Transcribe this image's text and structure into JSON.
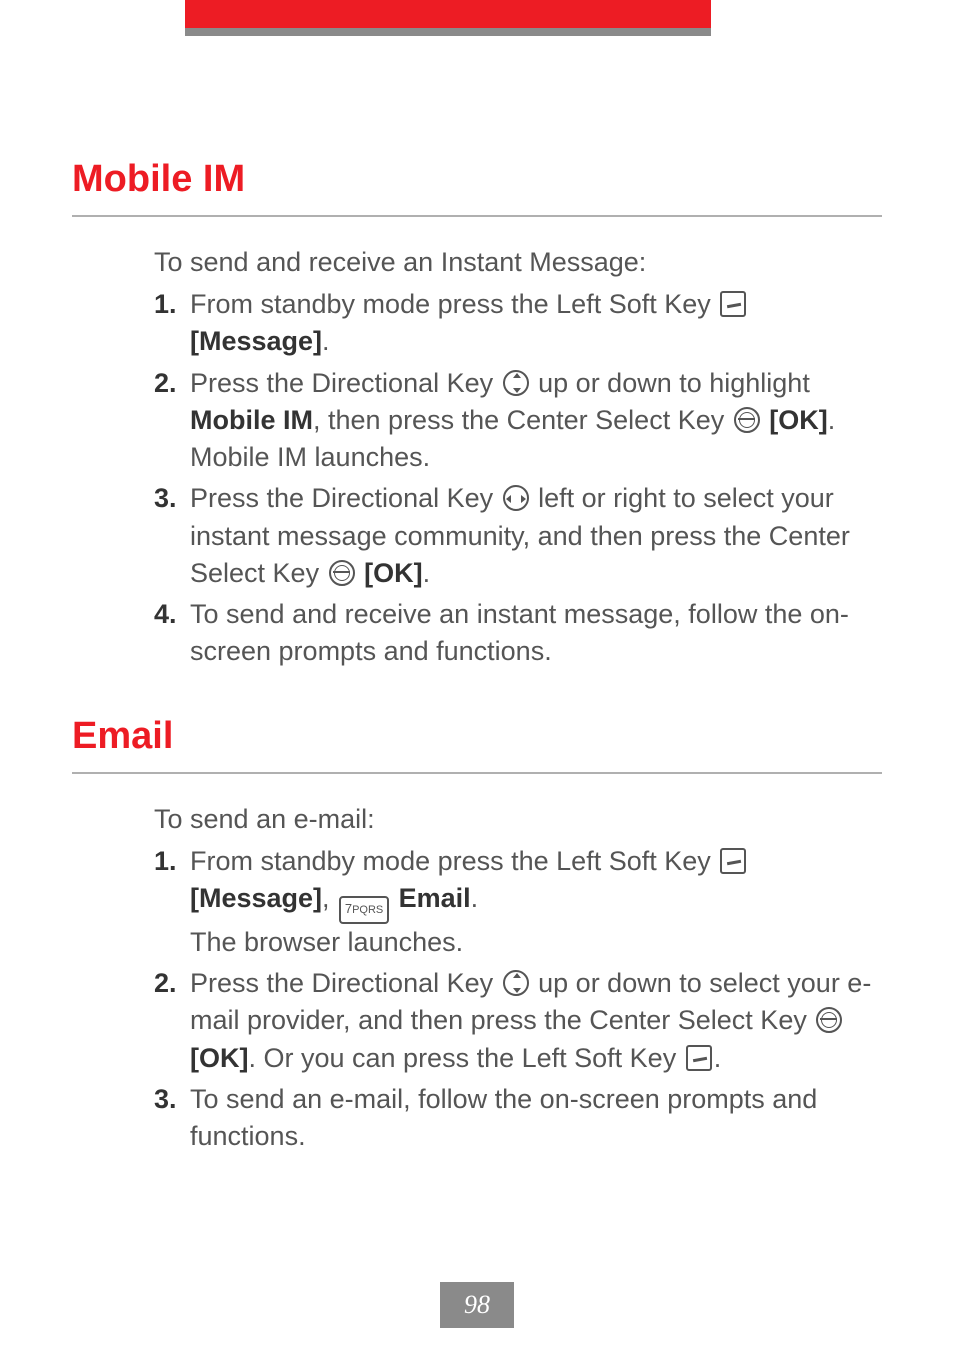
{
  "page_number": "98",
  "sections": [
    {
      "heading": "Mobile IM",
      "intro": "To send and receive an Instant Message:",
      "items": [
        {
          "num": "1.",
          "text1": "From standby mode press the Left Soft Key ",
          "bold1": "[Message]",
          "text2": "."
        },
        {
          "num": "2.",
          "text1": "Press the Directional Key ",
          "text2": " up or down to highlight ",
          "bold1": "Mobile IM",
          "text3": ", then press the Center Select Key ",
          "bold2": "[OK]",
          "text4": ".",
          "sub": "Mobile IM launches."
        },
        {
          "num": "3.",
          "text1": "Press the Directional Key ",
          "text2": " left or right to select your instant message community, and then press the Center Select Key ",
          "bold1": "[OK]",
          "text3": "."
        },
        {
          "num": "4.",
          "text1": "To send and receive an instant message, follow the on-screen prompts and functions."
        }
      ]
    },
    {
      "heading": "Email",
      "intro": "To send an e-mail:",
      "items": [
        {
          "num": "1.",
          "text1": "From standby mode press the Left Soft Key ",
          "bold1": "[Message]",
          "text2": ", ",
          "key7": "7PQRS",
          "bold2": " Email",
          "text3": ".",
          "sub": "The browser launches."
        },
        {
          "num": "2.",
          "text1": "Press the Directional Key ",
          "text2": " up or down to select your e-mail provider, and then press the Center Select Key ",
          "bold1": "[OK]",
          "text3": ". Or you can press the Left Soft Key ",
          "text4": "."
        },
        {
          "num": "3.",
          "text1": "To send an e-mail, follow the on-screen prompts and functions."
        }
      ]
    }
  ]
}
